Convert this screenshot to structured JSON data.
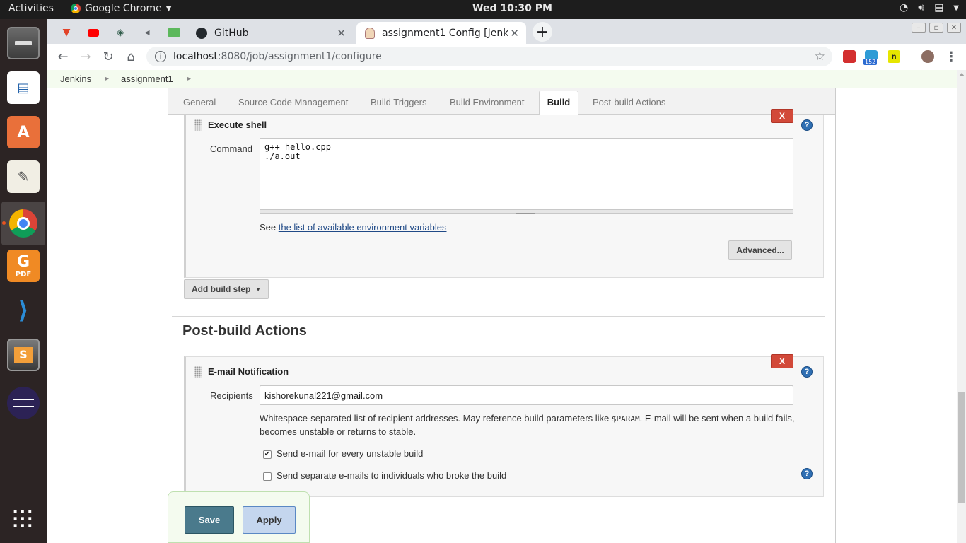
{
  "os": {
    "activities": "Activities",
    "app_name": "Google Chrome",
    "clock": "Wed 10:30 PM"
  },
  "dock": {
    "items": [
      "files-icon",
      "writer-icon",
      "software-icon",
      "text-editor-icon",
      "chrome-icon",
      "pdf-editor-icon",
      "vscode-icon",
      "sublime-icon",
      "eclipse-icon",
      "app-grid-icon"
    ],
    "pdf_label": "PDF",
    "accent_color": "#e95420"
  },
  "browser": {
    "tabs": [
      {
        "title": "GitHub"
      },
      {
        "title": "assignment1 Config [Jenk"
      }
    ],
    "url_host": "localhost",
    "url_path": ":8080/job/assignment1/configure",
    "extension_badge": "152"
  },
  "jenkins": {
    "breadcrumb": [
      "Jenkins",
      "assignment1"
    ],
    "config_tabs": [
      "General",
      "Source Code Management",
      "Build Triggers",
      "Build Environment",
      "Build",
      "Post-build Actions"
    ],
    "active_tab": "Build",
    "execute_shell": {
      "title": "Execute shell",
      "delete_label": "X",
      "command_label": "Command",
      "command_value": "g++ hello.cpp\n./a.out",
      "env_prefix": "See ",
      "env_link": "the list of available environment variables",
      "advanced_label": "Advanced..."
    },
    "add_build_step_label": "Add build step",
    "post_build": {
      "section_title": "Post-build Actions",
      "email_title": "E-mail Notification",
      "delete_label": "X",
      "recipients_label": "Recipients",
      "recipients_value": "kishorekunal221@gmail.com",
      "desc_part1": "Whitespace-separated list of recipient addresses. May reference build parameters like ",
      "desc_code": "$PARAM",
      "desc_part2": ". E-mail will be sent when a build fails, becomes unstable or returns to stable.",
      "checkbox_unstable": {
        "label": "Send e-mail for every unstable build",
        "checked": true
      },
      "checkbox_individuals": {
        "label": "Send separate e-mails to individuals who broke the build",
        "checked": false
      }
    },
    "save_label": "Save",
    "apply_label": "Apply"
  },
  "colors": {
    "jenkins_delete_red": "#d24939",
    "jenkins_help_blue": "#2f6fb3",
    "save_button": "#4a7a8c",
    "apply_button": "#c4d6ee"
  }
}
